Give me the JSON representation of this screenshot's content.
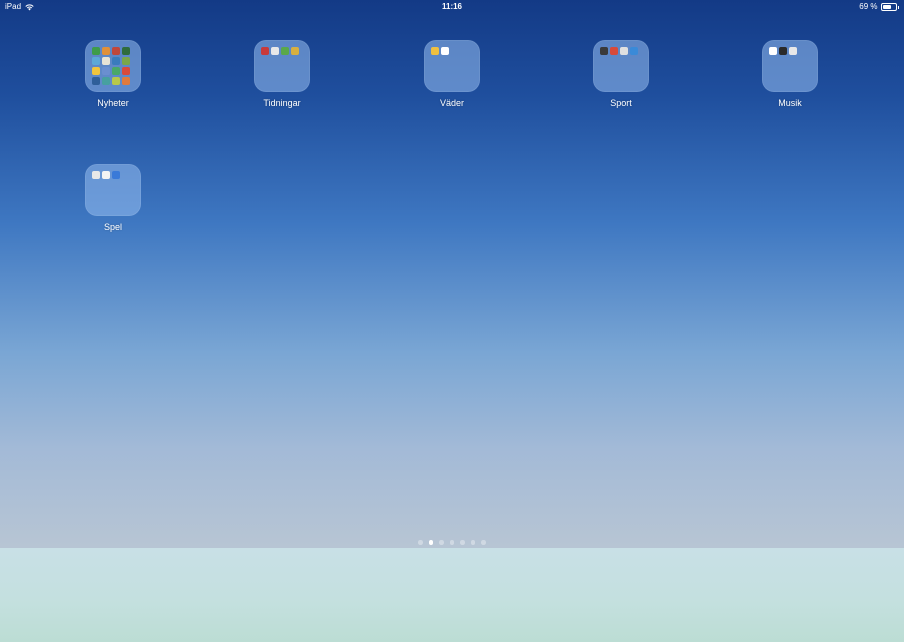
{
  "status_bar": {
    "device": "iPad",
    "time": "11:16",
    "battery_text": "69 %",
    "battery_level": 0.69
  },
  "folders": [
    {
      "label": "Nyheter",
      "icon_colors": [
        "#3e9c4a",
        "#e0903a",
        "#c0473b",
        "#2f6c3c",
        "#5ca8d8",
        "#e8e4d6",
        "#3a7bbd",
        "#7aa64a",
        "#f0c53e",
        "#6a8fd0",
        "#4aa868",
        "#d84a3c",
        "#2f5f9a",
        "#47a0a0",
        "#b8c84a",
        "#e07a3c"
      ]
    },
    {
      "label": "Tidningar",
      "icon_colors": [
        "#c83a3a",
        "#e8e8e8",
        "#5aa84a",
        "#d8b040"
      ]
    },
    {
      "label": "Väder",
      "icon_colors": [
        "#f0c040",
        "#ffffff"
      ]
    },
    {
      "label": "Sport",
      "icon_colors": [
        "#3a3a3a",
        "#d84a3a",
        "#e0e0e0",
        "#3a8ad8"
      ]
    },
    {
      "label": "Musik",
      "icon_colors": [
        "#ffffff",
        "#2a2a2a",
        "#e8e8e8"
      ]
    },
    {
      "label": "Spel",
      "icon_colors": [
        "#e8e8e8",
        "#f4f4f4",
        "#3a7ad8"
      ]
    }
  ],
  "page_indicator": {
    "total": 7,
    "current": 2
  }
}
